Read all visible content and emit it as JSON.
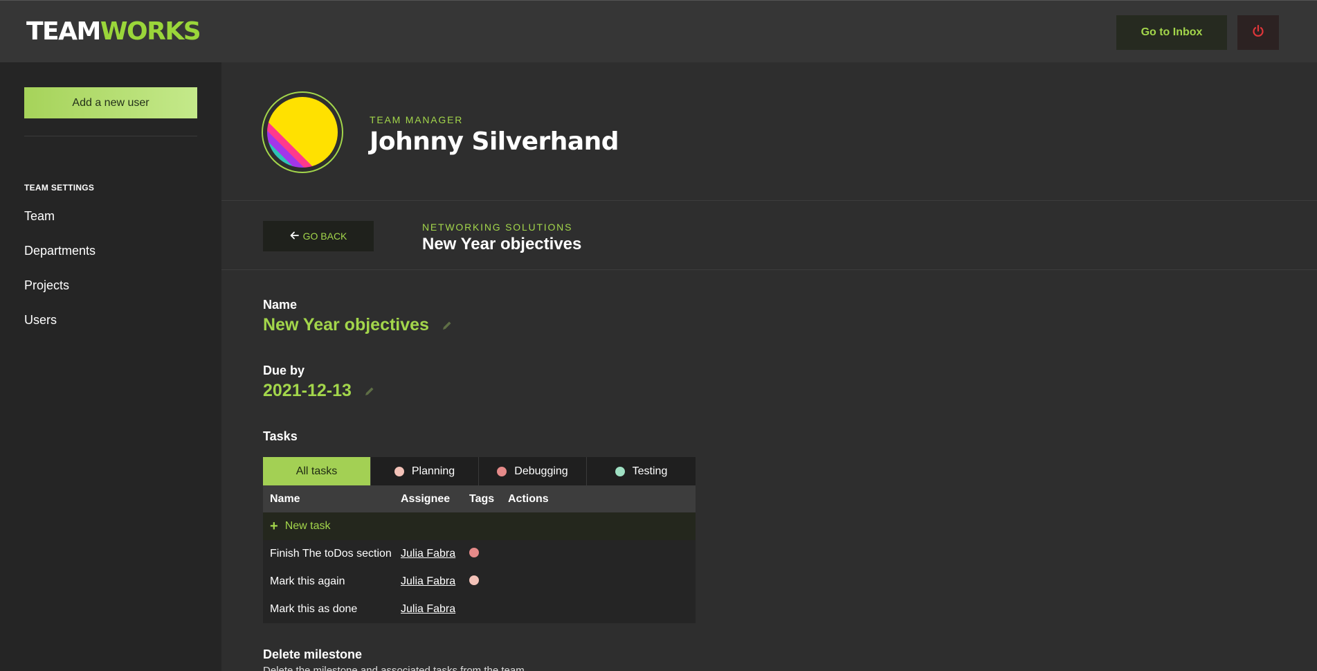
{
  "header": {
    "logo_part1": "TEAM",
    "logo_part2": "WORKS",
    "inbox_label": "Go to Inbox"
  },
  "sidebar": {
    "add_user_label": "Add a new user",
    "section_heading": "TEAM SETTINGS",
    "items": [
      {
        "label": "Team"
      },
      {
        "label": "Departments"
      },
      {
        "label": "Projects"
      },
      {
        "label": "Users"
      }
    ]
  },
  "profile": {
    "role": "TEAM MANAGER",
    "name": "Johnny Silverhand"
  },
  "subheader": {
    "go_back_label": "GO BACK",
    "project": "NETWORKING SOLUTIONS",
    "milestone": "New Year objectives"
  },
  "fields": {
    "name_label": "Name",
    "name_value": "New Year objectives",
    "due_label": "Due by",
    "due_value": "2021-12-13"
  },
  "tasks": {
    "heading": "Tasks",
    "tabs": [
      {
        "label": "All tasks",
        "active": true
      },
      {
        "label": "Planning",
        "color": "#f3c2b8"
      },
      {
        "label": "Debugging",
        "color": "#e58a89"
      },
      {
        "label": "Testing",
        "color": "#9fe0c3"
      }
    ],
    "columns": [
      "Name",
      "Assignee",
      "Tags",
      "Actions"
    ],
    "new_task_label": "New task",
    "rows": [
      {
        "name": "Finish The toDos section",
        "assignee": "Julia Fabra",
        "tag_color": "#e58a89"
      },
      {
        "name": "Mark this again",
        "assignee": "Julia Fabra",
        "tag_color": "#f3c2b8"
      },
      {
        "name": "Mark this as done",
        "assignee": "Julia Fabra",
        "tag_color": ""
      }
    ]
  },
  "delete": {
    "title": "Delete milestone",
    "description": "Delete the milestone and associated tasks from the team"
  },
  "colors": {
    "accent": "#a3d64b",
    "power_icon": "#e0363a"
  }
}
